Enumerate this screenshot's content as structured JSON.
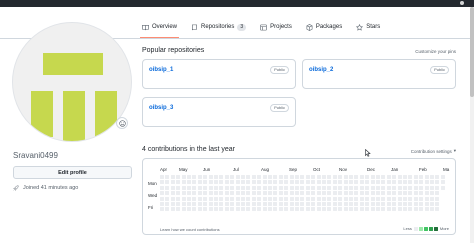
{
  "tabs": [
    {
      "label": "Overview",
      "icon": "book-open-icon",
      "active": true
    },
    {
      "label": "Repositories",
      "icon": "repo-icon",
      "count": "3"
    },
    {
      "label": "Projects",
      "icon": "table-icon"
    },
    {
      "label": "Packages",
      "icon": "package-icon"
    },
    {
      "label": "Stars",
      "icon": "star-icon"
    }
  ],
  "profile": {
    "username": "Sravani0499",
    "edit_label": "Edit profile",
    "joined": "Joined 41 minutes ago"
  },
  "popular": {
    "title": "Popular repositories",
    "customize": "Customize your pins",
    "repos": [
      {
        "name": "oibsip_1",
        "visibility": "Public"
      },
      {
        "name": "oibsip_2",
        "visibility": "Public"
      },
      {
        "name": "oibsip_3",
        "visibility": "Public"
      }
    ]
  },
  "contributions": {
    "title": "4 contributions in the last year",
    "settings": "Contribution settings",
    "months": [
      "Apr",
      "May",
      "Jun",
      "Jul",
      "Aug",
      "Sep",
      "Oct",
      "Nov",
      "Dec",
      "Jan",
      "Feb",
      "Ma"
    ],
    "days": [
      "Mon",
      "Wed",
      "Fri"
    ],
    "learn": "Learn how we count contributions",
    "less": "Less",
    "more": "More",
    "colors": [
      "#ebedf0",
      "#9be9a8",
      "#40c463",
      "#30a14e",
      "#216e39"
    ]
  }
}
